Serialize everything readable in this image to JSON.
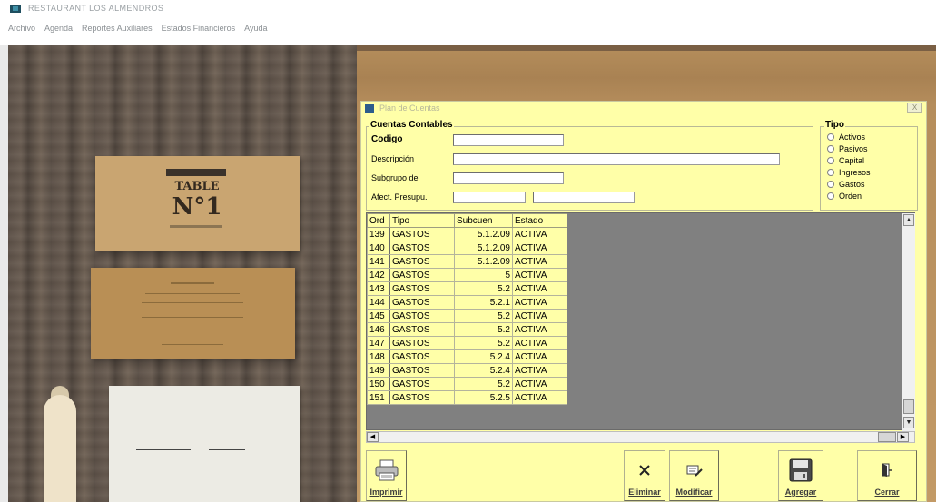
{
  "app": {
    "title": "RESTAURANT LOS ALMENDROS",
    "menu": [
      "Archivo",
      "Agenda",
      "Reportes Auxiliares",
      "Estados Financieros",
      "Ayuda"
    ]
  },
  "background": {
    "card_text_line1": "TABLE",
    "card_text_line2": "N°1"
  },
  "window": {
    "title": "Plan de Cuentas",
    "close_label": "X"
  },
  "form": {
    "group_label": "Cuentas Contables",
    "codigo_label": "Codigo",
    "codigo_value": "",
    "descripcion_label": "Descripción",
    "descripcion_value": "",
    "subgrupo_label": "Subgrupo de",
    "subgrupo_value": "",
    "afect_label": "Afect. Presupu.",
    "afect_value1": "",
    "afect_value2": ""
  },
  "tipo": {
    "group_label": "Tipo",
    "options": [
      "Activos",
      "Pasivos",
      "Capital",
      "Ingresos",
      "Gastos",
      "Orden"
    ]
  },
  "grid": {
    "headers": [
      "Ord",
      "Tipo",
      "Subcuen",
      "Estado"
    ],
    "rows": [
      {
        "ord": "139",
        "tipo": "GASTOS",
        "subcuenta": "5.1.2.09",
        "estado": "ACTIVA"
      },
      {
        "ord": "140",
        "tipo": "GASTOS",
        "subcuenta": "5.1.2.09",
        "estado": "ACTIVA"
      },
      {
        "ord": "141",
        "tipo": "GASTOS",
        "subcuenta": "5.1.2.09",
        "estado": "ACTIVA"
      },
      {
        "ord": "142",
        "tipo": "GASTOS",
        "subcuenta": "5",
        "estado": "ACTIVA"
      },
      {
        "ord": "143",
        "tipo": "GASTOS",
        "subcuenta": "5.2",
        "estado": "ACTIVA"
      },
      {
        "ord": "144",
        "tipo": "GASTOS",
        "subcuenta": "5.2.1",
        "estado": "ACTIVA"
      },
      {
        "ord": "145",
        "tipo": "GASTOS",
        "subcuenta": "5.2",
        "estado": "ACTIVA"
      },
      {
        "ord": "146",
        "tipo": "GASTOS",
        "subcuenta": "5.2",
        "estado": "ACTIVA"
      },
      {
        "ord": "147",
        "tipo": "GASTOS",
        "subcuenta": "5.2",
        "estado": "ACTIVA"
      },
      {
        "ord": "148",
        "tipo": "GASTOS",
        "subcuenta": "5.2.4",
        "estado": "ACTIVA"
      },
      {
        "ord": "149",
        "tipo": "GASTOS",
        "subcuenta": "5.2.4",
        "estado": "ACTIVA"
      },
      {
        "ord": "150",
        "tipo": "GASTOS",
        "subcuenta": "5.2",
        "estado": "ACTIVA"
      },
      {
        "ord": "151",
        "tipo": "GASTOS",
        "subcuenta": "5.2.5",
        "estado": "ACTIVA"
      }
    ]
  },
  "toolbar": {
    "imprimir_label": "Imprimir",
    "eliminar_label": "Eliminar",
    "modificar_label": "Modificar",
    "agregar_label": "Agregar",
    "cerrar_label": "Cerrar"
  },
  "scroll": {
    "up": "▲",
    "down": "▼",
    "left": "◀",
    "right": "▶"
  },
  "colors": {
    "form_background": "#ffffa8",
    "grid_empty_area": "#808080"
  }
}
